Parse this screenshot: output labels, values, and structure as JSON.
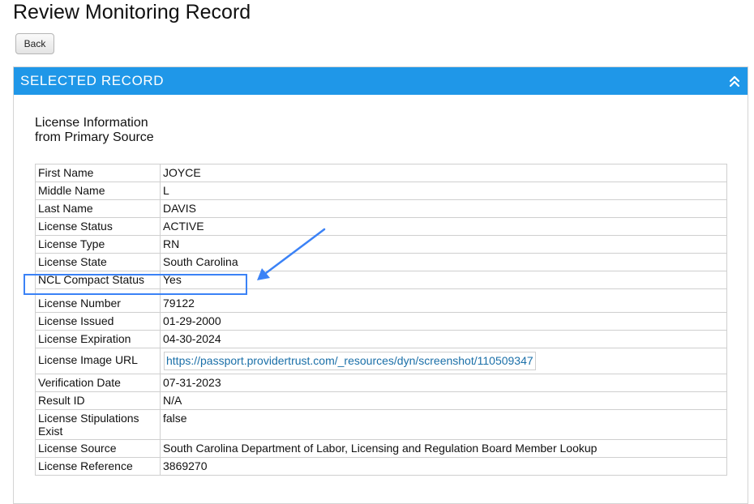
{
  "page": {
    "title": "Review Monitoring Record"
  },
  "toolbar": {
    "back_label": "Back"
  },
  "panel": {
    "title": "SELECTED RECORD",
    "icon": "chevron-double-up-icon",
    "accent_color": "#1f97e8"
  },
  "section": {
    "heading": "License Information from Primary Source"
  },
  "rows": [
    {
      "label": "First Name",
      "value": "JOYCE"
    },
    {
      "label": "Middle Name",
      "value": "L"
    },
    {
      "label": "Last Name",
      "value": "DAVIS"
    },
    {
      "label": "License Status",
      "value": "ACTIVE"
    },
    {
      "label": "License Type",
      "value": "RN"
    },
    {
      "label": "License State",
      "value": "South Carolina"
    },
    {
      "label": "NCL Compact Status",
      "value": "Yes"
    },
    {
      "label": "License Number",
      "value": "79122"
    },
    {
      "label": "License Issued",
      "value": "01-29-2000"
    },
    {
      "label": "License Expiration",
      "value": "04-30-2024"
    },
    {
      "label": "License Image URL",
      "value": "https://passport.providertrust.com/_resources/dyn/screenshot/110509347"
    },
    {
      "label": "Verification Date",
      "value": "07-31-2023"
    },
    {
      "label": "Result ID",
      "value": "N/A"
    },
    {
      "label": "License Stipulations Exist",
      "value": "false"
    },
    {
      "label": "License Source",
      "value": "South Carolina Department of Labor, Licensing and Regulation Board Member Lookup"
    },
    {
      "label": "License Reference",
      "value": "3869270"
    }
  ],
  "annotation": {
    "highlight_color": "#3b82f6"
  }
}
